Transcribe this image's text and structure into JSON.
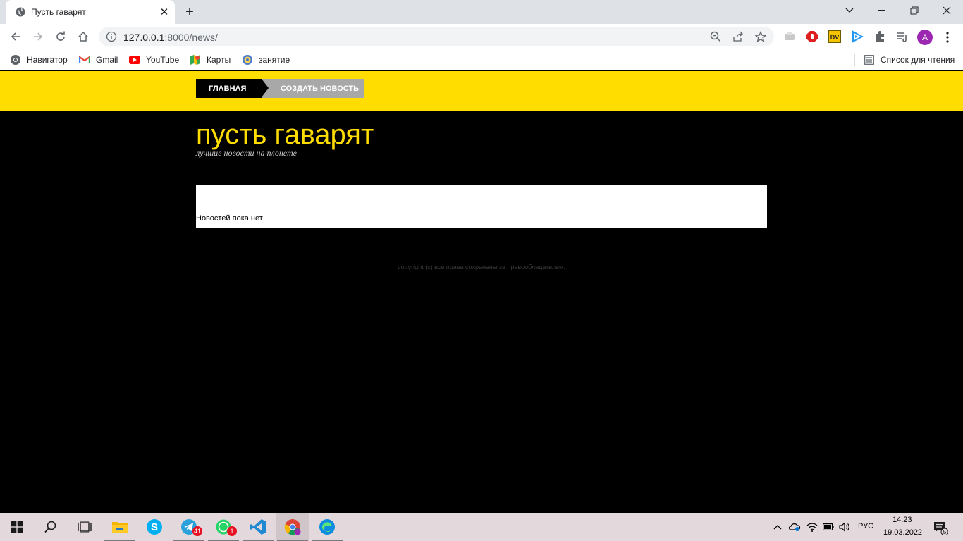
{
  "browser": {
    "tab_title": "Пусть гаварят",
    "url_host": "127.0.0.1",
    "url_rest": ":8000/news/",
    "profile_initial": "A",
    "ext_dv_label": "DV"
  },
  "bookmarks": [
    {
      "label": "Навигатор",
      "icon": "chrome-icon"
    },
    {
      "label": "Gmail",
      "icon": "gmail-icon"
    },
    {
      "label": "YouTube",
      "icon": "youtube-icon"
    },
    {
      "label": "Карты",
      "icon": "maps-icon"
    },
    {
      "label": "занятие",
      "icon": "settings-icon"
    }
  ],
  "reading_list_label": "Список для чтения",
  "site": {
    "nav_home": "ГЛАВНАЯ",
    "nav_create": "СОЗДАТЬ НОВОСТЬ",
    "title": "пусть гаварят",
    "tagline": "лучшие новости на плонете",
    "empty_message": "Новостей пока нет",
    "copyright": "copyright (c) все права сохранены за правообладателем.",
    "colors": {
      "accent": "#ffdd00",
      "background": "#000000",
      "nav_inactive": "#a8a8a8"
    }
  },
  "taskbar": {
    "telegram_badge": "41",
    "whatsapp_badge": "1",
    "language": "РУС",
    "time": "14:23",
    "date": "19.03.2022",
    "notifications_count": "5"
  }
}
